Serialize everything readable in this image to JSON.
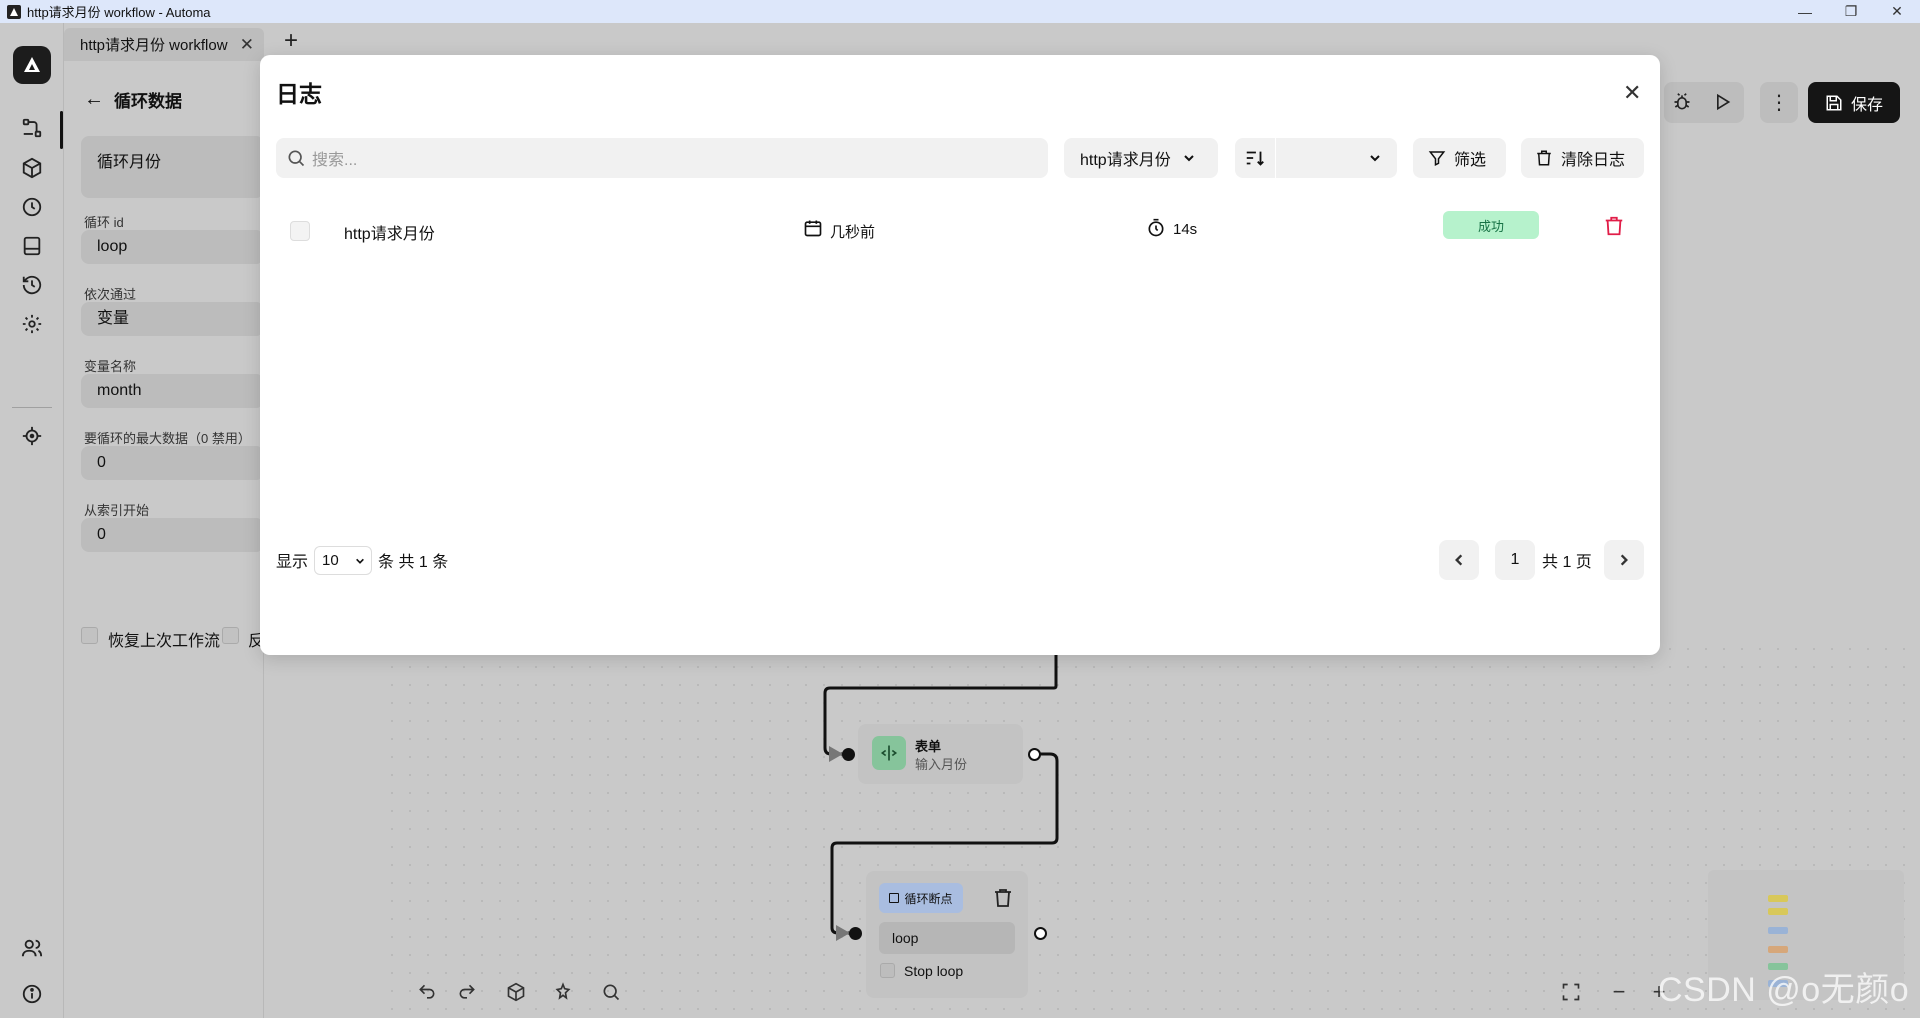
{
  "window": {
    "title": "http请求月份 workflow - Automa",
    "min": "—",
    "max": "❐",
    "close": "✕"
  },
  "tabs": {
    "active_label": "http请求月份 workflow",
    "close": "✕",
    "new": "+"
  },
  "editor_panel": {
    "back_label": "循环数据",
    "block_name": "循环月份",
    "fields": [
      {
        "label": "循环 id",
        "value": "loop"
      },
      {
        "label": "依次通过",
        "value": "变量"
      },
      {
        "label": "变量名称",
        "value": "month"
      },
      {
        "label": "要循环的最大数据（0 禁用）",
        "value": "0"
      },
      {
        "label": "从索引开始",
        "value": "0"
      }
    ],
    "restore_label": "恢复上次工作流",
    "reverse_label_fragment": "反"
  },
  "top_toolbar": {
    "save_label": "保存"
  },
  "logs_modal": {
    "title": "日志",
    "close": "✕",
    "search_placeholder": "搜索...",
    "workflow_filter": "http请求月份",
    "sort_value": "",
    "filter_label": "筛选",
    "clear_label": "清除日志",
    "rows": [
      {
        "name": "http请求月份",
        "time": "几秒前",
        "duration": "14s",
        "status": "成功"
      }
    ],
    "footer": {
      "show_label": "显示",
      "page_size": "10",
      "count_label": "条 共 1 条",
      "page": "1",
      "total_pages": "共 1 页"
    }
  },
  "canvas_nodes": {
    "form": {
      "title": "表单",
      "subtitle": "输入月份"
    },
    "loop_breakpoint": {
      "label": "循环断点",
      "loop_id": "loop",
      "stop_label": "Stop loop"
    }
  },
  "watermark": "CSDN @o无颜o",
  "colors": {
    "success_bg": "#b6f2cc",
    "success_text": "#177245",
    "delete_red": "#e11d48",
    "form_node_icon_bg": "#86c49b",
    "loop_node_label_bg": "#a9bde0",
    "save_button": "#151515"
  }
}
